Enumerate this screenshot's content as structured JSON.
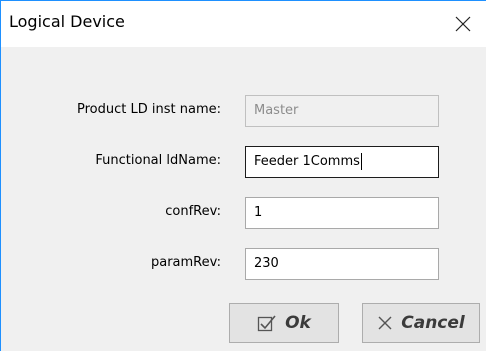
{
  "window": {
    "title": "Logical Device",
    "close_icon": "close-icon"
  },
  "fields": [
    {
      "label": "Product LD inst name:",
      "value": "Master",
      "disabled": true
    },
    {
      "label": "Functional ldName:",
      "value": "Feeder 1Comms",
      "focused": true
    },
    {
      "label": "confRev:",
      "value": "1"
    },
    {
      "label": "paramRev:",
      "value": "230"
    }
  ],
  "buttons": {
    "ok_label": "Ok",
    "ok_icon": "checkbox-icon",
    "cancel_label": "Cancel",
    "cancel_icon": "cross-icon"
  },
  "colors": {
    "accent_border": "#1e90ff",
    "dialog_background": "#f0f0f0",
    "button_background": "#e3e3e3"
  }
}
